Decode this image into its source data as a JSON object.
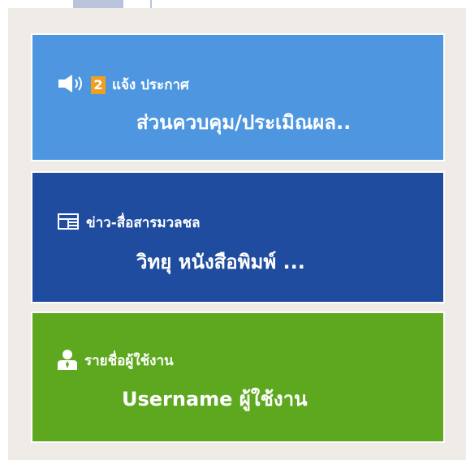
{
  "tiles": {
    "announcements": {
      "icon": "speaker-icon",
      "count": "2",
      "title": "แจ้ง ประกาศ",
      "subtitle": "ส่วนควบคุม/ประเมิณผล.."
    },
    "news": {
      "icon": "newspaper-icon",
      "title": "ข่าว-สื่อสารมวลชล",
      "subtitle": "วิทยุ หนังสือพิมพ์ ..."
    },
    "user": {
      "icon": "user-icon",
      "title": "รายชื่อผู้ใช้งาน",
      "subtitle": "Username ผู้ใช้งาน"
    }
  },
  "colors": {
    "announcements_bg": "#4e97e0",
    "news_bg": "#1f4c9e",
    "user_bg": "#5ea81f",
    "badge_bg": "#f0a020",
    "panel_bg": "#efece7"
  }
}
